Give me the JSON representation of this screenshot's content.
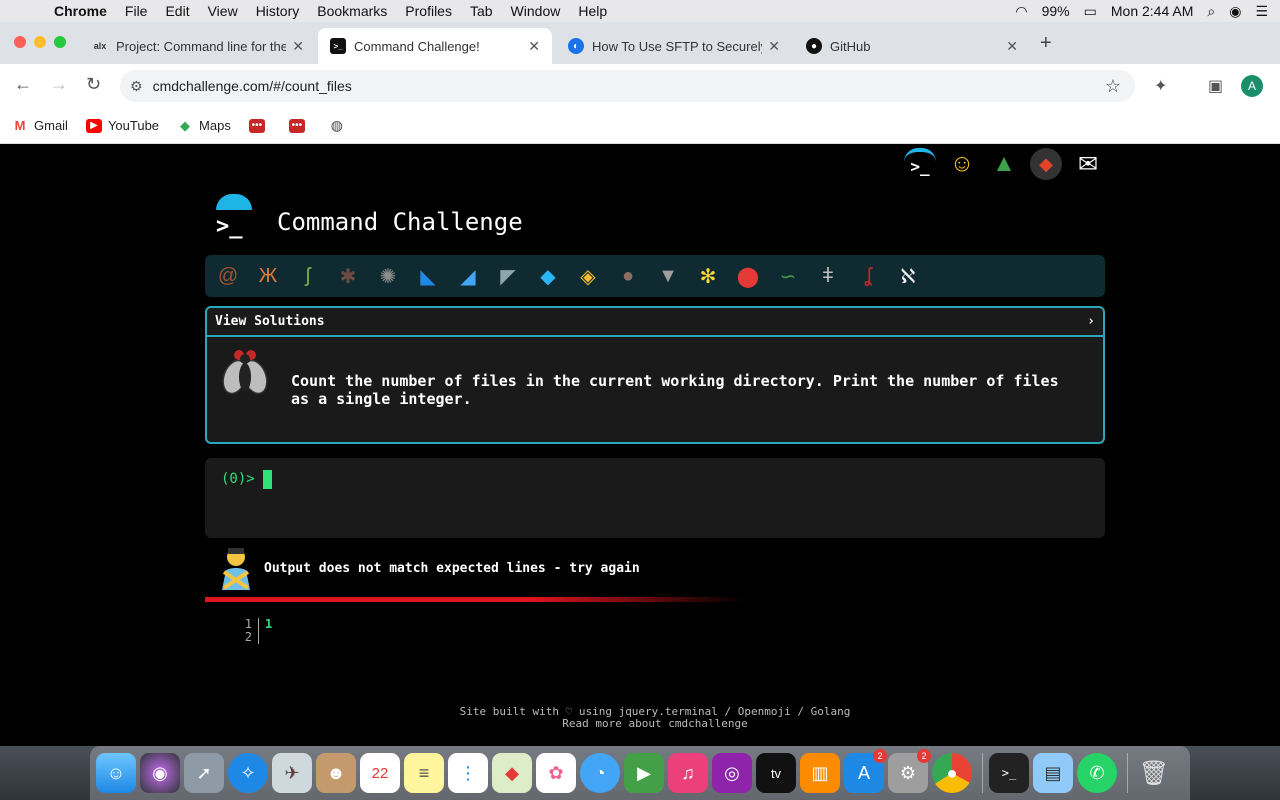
{
  "menubar": {
    "app_name": "Chrome",
    "items": [
      "File",
      "Edit",
      "View",
      "History",
      "Bookmarks",
      "Profiles",
      "Tab",
      "Window",
      "Help"
    ],
    "battery": "99%",
    "clock": "Mon 2:44 AM"
  },
  "tabs": [
    {
      "favicon": "alx",
      "title": "Project: Command line for the",
      "active": false
    },
    {
      "favicon": "terminal",
      "title": "Command Challenge!",
      "active": true
    },
    {
      "favicon": "digitalocean",
      "title": "How To Use SFTP to Securely",
      "active": false
    },
    {
      "favicon": "github",
      "title": "GitHub",
      "active": false
    }
  ],
  "omnibox": {
    "url": "cmdchallenge.com/#/count_files"
  },
  "profile_initial": "A",
  "bookmarks": [
    {
      "label": "Gmail",
      "icon": "gmail-icon"
    },
    {
      "label": "YouTube",
      "icon": "youtube-icon"
    },
    {
      "label": "Maps",
      "icon": "maps-icon"
    }
  ],
  "page": {
    "title": "Command Challenge",
    "solutions_label": "View Solutions",
    "solutions_chevron": "›",
    "task": "Count the number of files in the current working directory. Print the number of files as a single integer.",
    "prompt": "(0)>",
    "feedback": "Output does not match expected lines - try again",
    "output_lines": [
      {
        "num": "1",
        "text": "1"
      },
      {
        "num": "2",
        "text": ""
      }
    ],
    "footer_line1": "Site built with ♡ using jquery.terminal / Openmoji / Golang",
    "footer_line2": "Read more about cmdchallenge"
  },
  "colors": {
    "accent_teal": "#2aa7b8",
    "prompt_green": "#2fe07a",
    "error_red": "#e0141f"
  },
  "dock_badges": {
    "appstore": "2",
    "settings": "2"
  }
}
